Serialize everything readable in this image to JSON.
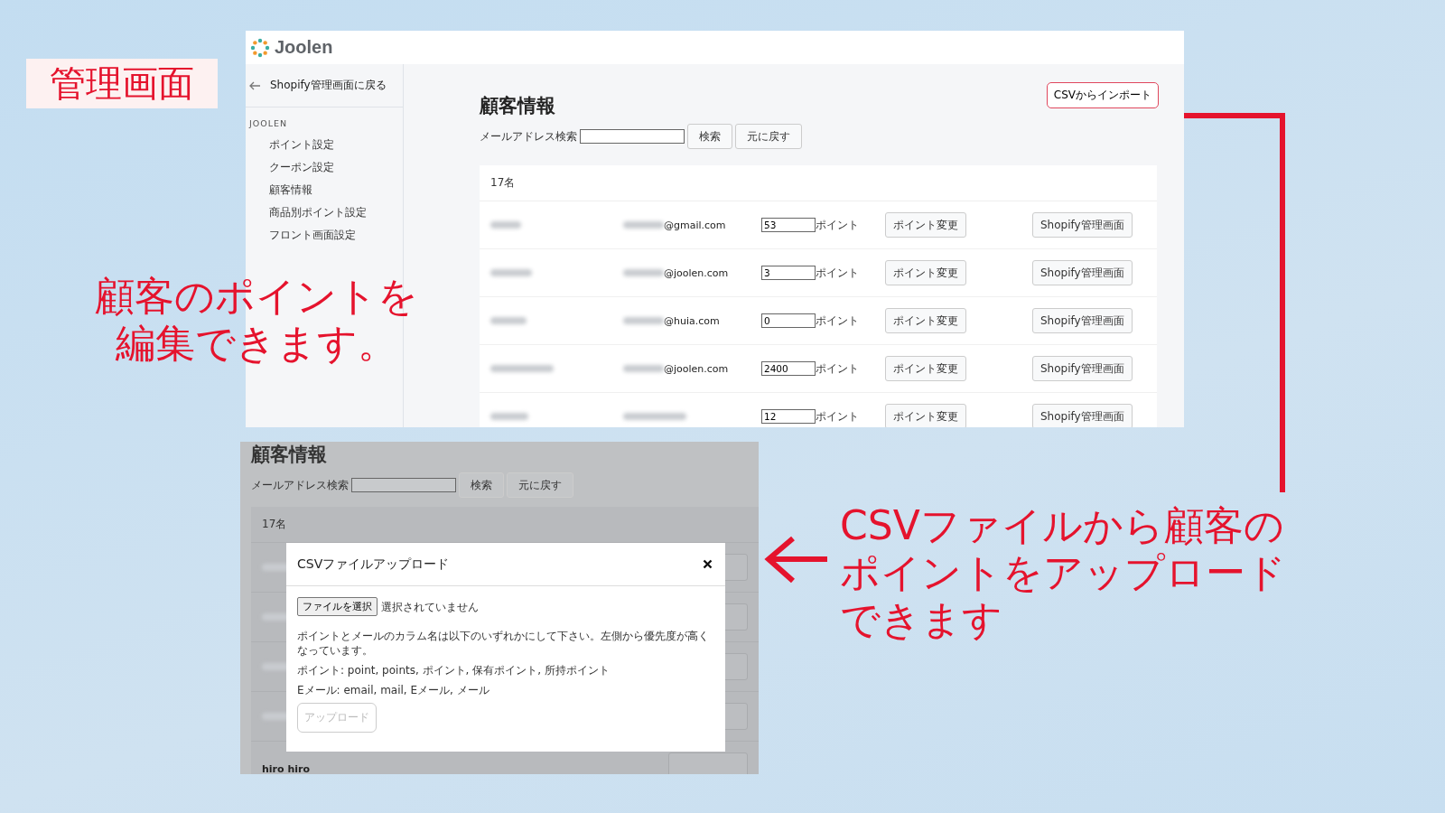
{
  "slide": {
    "title_tag": "管理画面",
    "left_note": [
      "顧客のポイントを",
      "編集できます。"
    ],
    "right_note": [
      "CSVファイルから顧客の",
      "ポイントをアップロード",
      "できます"
    ]
  },
  "admin": {
    "brand": "Joolen",
    "back_link": "Shopify管理画面に戻る",
    "nav_section": "JOOLEN",
    "nav_items": [
      "ポイント設定",
      "クーポン設定",
      "顧客情報",
      "商品別ポイント設定",
      "フロント画面設定"
    ],
    "page_title": "顧客情報",
    "import_button": "CSVからインポート",
    "search_label": "メールアドレス検索",
    "search_button": "検索",
    "reset_button": "元に戻す",
    "count": "17名",
    "customers": [
      {
        "email": "@gmail.com",
        "points": "53",
        "unit": "ポイント",
        "change_button": "ポイント変更",
        "shopify_button": "Shopify管理画面"
      },
      {
        "email": "@joolen.com",
        "points": "3",
        "unit": "ポイント",
        "change_button": "ポイント変更",
        "shopify_button": "Shopify管理画面"
      },
      {
        "email": "@huia.com",
        "points": "0",
        "unit": "ポイント",
        "change_button": "ポイント変更",
        "shopify_button": "Shopify管理画面"
      },
      {
        "email": "@joolen.com",
        "points": "2400",
        "unit": "ポイント",
        "change_button": "ポイント変更",
        "shopify_button": "Shopify管理画面"
      },
      {
        "points": "12",
        "unit": "ポイント",
        "change_button": "ポイント変更",
        "shopify_button": "Shopify管理画面"
      }
    ]
  },
  "upload_screen": {
    "page_title": "顧客情報",
    "search_label": "メールアドレス検索",
    "search_button": "検索",
    "reset_button": "元に戻す",
    "count": "17名",
    "last_row_name": "hiro hiro",
    "modal": {
      "title": "CSVファイルアップロード",
      "file_button": "ファイルを選択",
      "file_status": "選択されていません",
      "instructions": "ポイントとメールのカラム名は以下のいずれかにして下さい。左側から優先度が高くなっています。",
      "point_columns": "ポイント: point, points, ポイント, 保有ポイント, 所持ポイント",
      "email_columns": "Eメール: email, mail, Eメール, メール",
      "upload_button": {
        "label": "アップロード",
        "disabled": true
      }
    }
  }
}
